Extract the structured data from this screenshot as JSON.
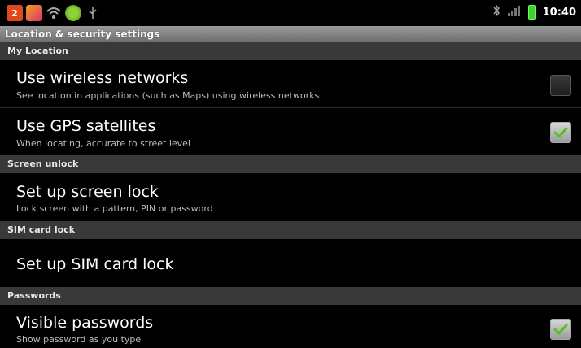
{
  "statusbar": {
    "notification_count": "2",
    "time": "10:40"
  },
  "window_title": "Location & security settings",
  "sections": {
    "my_location": "My Location",
    "screen_unlock": "Screen unlock",
    "sim_card_lock": "SIM card lock",
    "passwords": "Passwords"
  },
  "items": {
    "wireless": {
      "title": "Use wireless networks",
      "summary": "See location in applications (such as Maps) using wireless networks",
      "checked": false
    },
    "gps": {
      "title": "Use GPS satellites",
      "summary": "When locating, accurate to street level",
      "checked": true
    },
    "screen_lock": {
      "title": "Set up screen lock",
      "summary": "Lock screen with a pattern, PIN or password"
    },
    "sim_lock": {
      "title": "Set up SIM card lock"
    },
    "visible_passwords": {
      "title": "Visible passwords",
      "summary": "Show password as you type",
      "checked": true
    }
  },
  "colors": {
    "check_green": "#4fc31f",
    "section_bg": "#393939",
    "title_bar_bg": "#8a8a8a"
  },
  "icons": [
    "notification-count-icon",
    "app-notification-icon",
    "wifi-icon",
    "green-app-icon",
    "usb-icon",
    "bluetooth-icon",
    "signal-icon",
    "battery-icon"
  ]
}
